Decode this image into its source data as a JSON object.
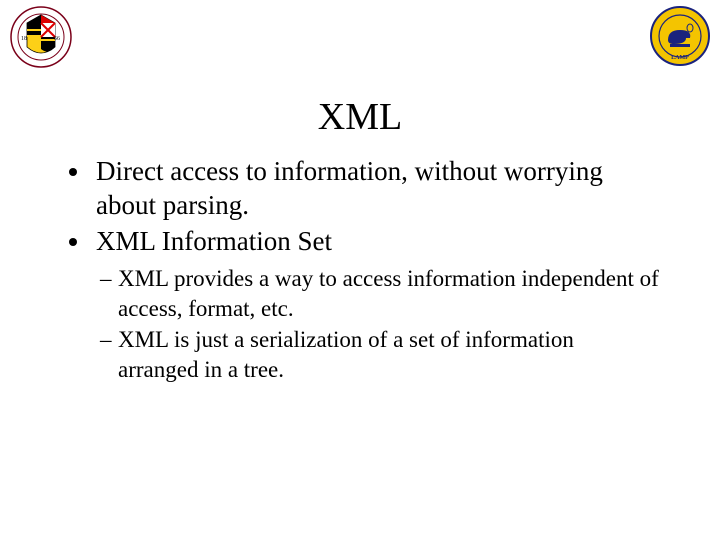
{
  "title": "XML",
  "bullets": [
    "Direct access to information, without worrying about parsing.",
    "XML Information Set"
  ],
  "sub_bullets": [
    "XML provides a way to access information independent of access, format, etc.",
    "XML is just a serialization of a set of information arranged in a tree."
  ],
  "logos": {
    "left": "university-of-maryland-seal",
    "right": "lamp-seal"
  }
}
